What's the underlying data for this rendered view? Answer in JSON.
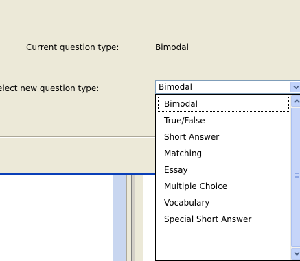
{
  "dialog": {
    "current_type_label": "Current question type:",
    "current_type_value": "Bimodal",
    "new_type_label": "elect new question type:"
  },
  "combo": {
    "selected_value": "Bimodal",
    "options": [
      "Bimodal",
      "True/False",
      "Short Answer",
      "Matching",
      "Essay",
      "Multiple Choice",
      "Vocabulary",
      "Special Short Answer"
    ],
    "highlighted_index": 0
  },
  "colors": {
    "dialog_bg": "#ece9d8",
    "accent_line": "#0a3fb8",
    "scroll_button": "#c1d3fb"
  },
  "icons": {
    "combo_arrow": "chevron-down-icon",
    "scroll_up": "chevron-up-icon",
    "scroll_down": "chevron-down-icon"
  }
}
